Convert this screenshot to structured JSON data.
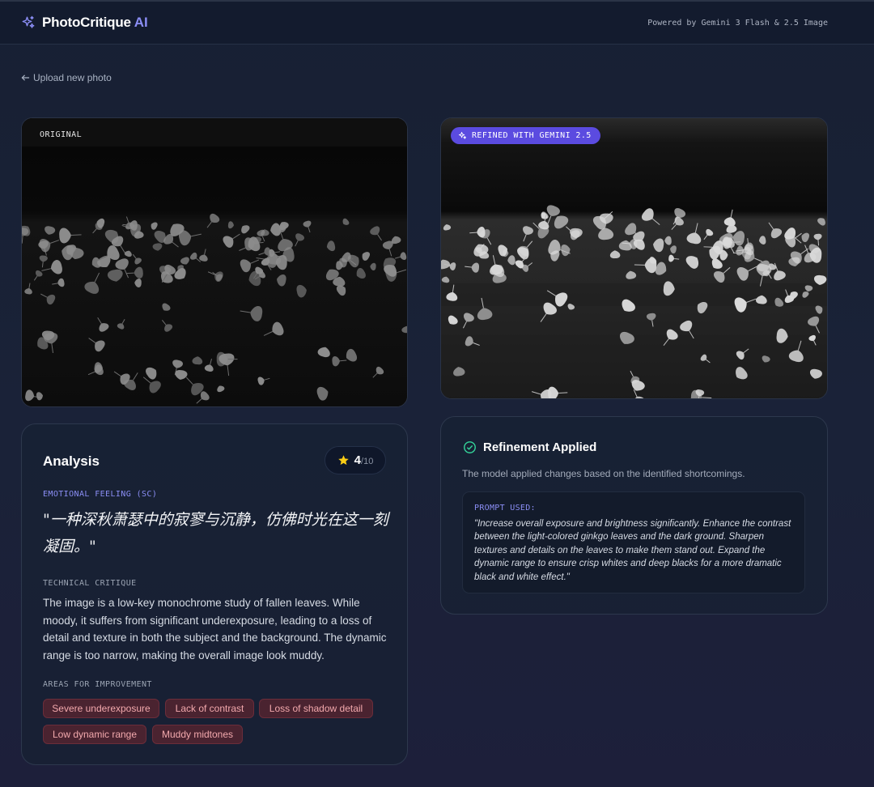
{
  "header": {
    "brand_name": "PhotoCritique",
    "brand_accent": "AI",
    "powered_by": "Powered by Gemini 3 Flash & 2.5 Image",
    "brand_icon": "sparkles-icon"
  },
  "nav": {
    "back_label": "Upload new photo",
    "back_icon": "arrow-left-icon"
  },
  "photos": {
    "original_label": "ORIGINAL",
    "refined_label": "REFINED WITH GEMINI 2.5",
    "refined_icon": "sparkles-icon"
  },
  "analysis": {
    "title": "Analysis",
    "score": "4",
    "score_max": "/10",
    "score_icon": "star-icon",
    "emotion_label": "EMOTIONAL FEELING (SC)",
    "emotion_quote": "\"一种深秋萧瑟中的寂寥与沉静，仿佛时光在这一刻凝固。\"",
    "technical_label": "TECHNICAL CRITIQUE",
    "technical_text": "The image is a low-key monochrome study of fallen leaves. While moody, it suffers from significant underexposure, leading to a loss of detail and texture in both the subject and the background. The dynamic range is too narrow, making the overall image look muddy.",
    "areas_label": "AREAS FOR IMPROVEMENT",
    "areas": [
      "Severe underexposure",
      "Lack of contrast",
      "Loss of shadow detail",
      "Low dynamic range",
      "Muddy midtones"
    ]
  },
  "refinement": {
    "title": "Refinement Applied",
    "status_icon": "check-circle-icon",
    "description": "The model applied changes based on the identified shortcomings.",
    "prompt_label": "PROMPT USED:",
    "prompt_text": "\"Increase overall exposure and brightness significantly. Enhance the contrast between the light-colored ginkgo leaves and the dark ground. Sharpen textures and details on the leaves to make them stand out. Expand the dynamic range to ensure crisp whites and deep blacks for a more dramatic black and white effect.\""
  },
  "colors": {
    "accent": "#8b8ef5",
    "refined_badge": "#5b4be0",
    "chip_text": "#f3a9ad",
    "chip_bg": "#4a2330",
    "success": "#34d399",
    "star": "#facc15"
  }
}
